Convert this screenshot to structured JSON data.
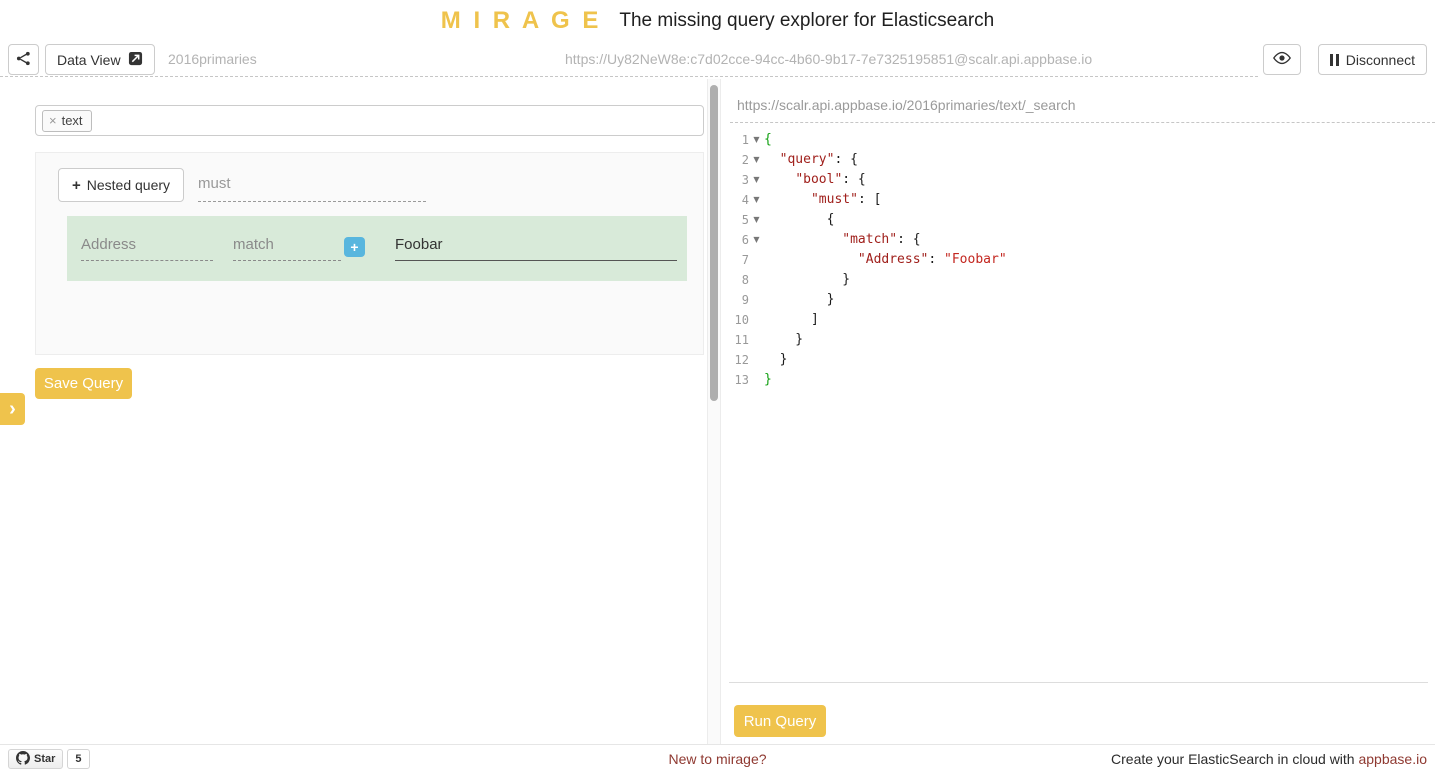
{
  "header": {
    "logo": "M I R A G E",
    "tagline": "The missing query explorer for Elasticsearch"
  },
  "toolbar": {
    "data_view_label": "Data View",
    "index_name": "2016primaries",
    "connection_url": "https://Uy82NeW8e:c7d02cce-94cc-4b60-9b17-7e7325195851@scalr.api.appbase.io",
    "disconnect_label": "Disconnect"
  },
  "builder": {
    "type_tag": "text",
    "remove_tag_glyph": "×",
    "nested_query_plus": "+",
    "nested_query_label": "Nested query",
    "bool_clause": "must",
    "condition": {
      "field": "Address",
      "operator": "match",
      "add_glyph": "+",
      "value": "Foobar"
    },
    "save_button_label": "Save Query",
    "expand_tab_glyph": "›"
  },
  "preview": {
    "request_url": "https://scalr.api.appbase.io/2016primaries/text/_search",
    "run_button_label": "Run Query"
  },
  "editor": {
    "fold_glyph": "▼",
    "lines": [
      {
        "n": "1",
        "fold": true,
        "tokens": [
          [
            "g",
            "{"
          ]
        ]
      },
      {
        "n": "2",
        "fold": true,
        "tokens": [
          [
            "p",
            "  "
          ],
          [
            "k",
            "\"query\""
          ],
          [
            "p",
            ": {"
          ]
        ]
      },
      {
        "n": "3",
        "fold": true,
        "tokens": [
          [
            "p",
            "    "
          ],
          [
            "k",
            "\"bool\""
          ],
          [
            "p",
            ": {"
          ]
        ]
      },
      {
        "n": "4",
        "fold": true,
        "tokens": [
          [
            "p",
            "      "
          ],
          [
            "k",
            "\"must\""
          ],
          [
            "p",
            ": ["
          ]
        ]
      },
      {
        "n": "5",
        "fold": true,
        "tokens": [
          [
            "p",
            "        {"
          ]
        ]
      },
      {
        "n": "6",
        "fold": true,
        "tokens": [
          [
            "p",
            "          "
          ],
          [
            "k",
            "\"match\""
          ],
          [
            "p",
            ": {"
          ]
        ]
      },
      {
        "n": "7",
        "fold": false,
        "tokens": [
          [
            "p",
            "            "
          ],
          [
            "k",
            "\"Address\""
          ],
          [
            "p",
            ": "
          ],
          [
            "s",
            "\"Foobar\""
          ]
        ]
      },
      {
        "n": "8",
        "fold": false,
        "tokens": [
          [
            "p",
            "          }"
          ]
        ]
      },
      {
        "n": "9",
        "fold": false,
        "tokens": [
          [
            "p",
            "        }"
          ]
        ]
      },
      {
        "n": "10",
        "fold": false,
        "tokens": [
          [
            "p",
            "      ]"
          ]
        ]
      },
      {
        "n": "11",
        "fold": false,
        "tokens": [
          [
            "p",
            "    }"
          ]
        ]
      },
      {
        "n": "12",
        "fold": false,
        "tokens": [
          [
            "p",
            "  }"
          ]
        ]
      },
      {
        "n": "13",
        "fold": false,
        "tokens": [
          [
            "g",
            "}"
          ]
        ]
      }
    ]
  },
  "footer": {
    "star_label": "Star",
    "star_count": "5",
    "new_to_mirage": "New to mirage?",
    "cloud_text": "Create your ElasticSearch in cloud with",
    "cloud_link": "appbase.io"
  },
  "colors": {
    "brand_gold": "#efc34c",
    "accent_blue": "#58b6de",
    "row_green": "#d8ead9",
    "link_maroon": "#8f3931",
    "code_key": "#a0201c",
    "code_string": "#c3261f",
    "code_bracket_match": "#11a011"
  }
}
